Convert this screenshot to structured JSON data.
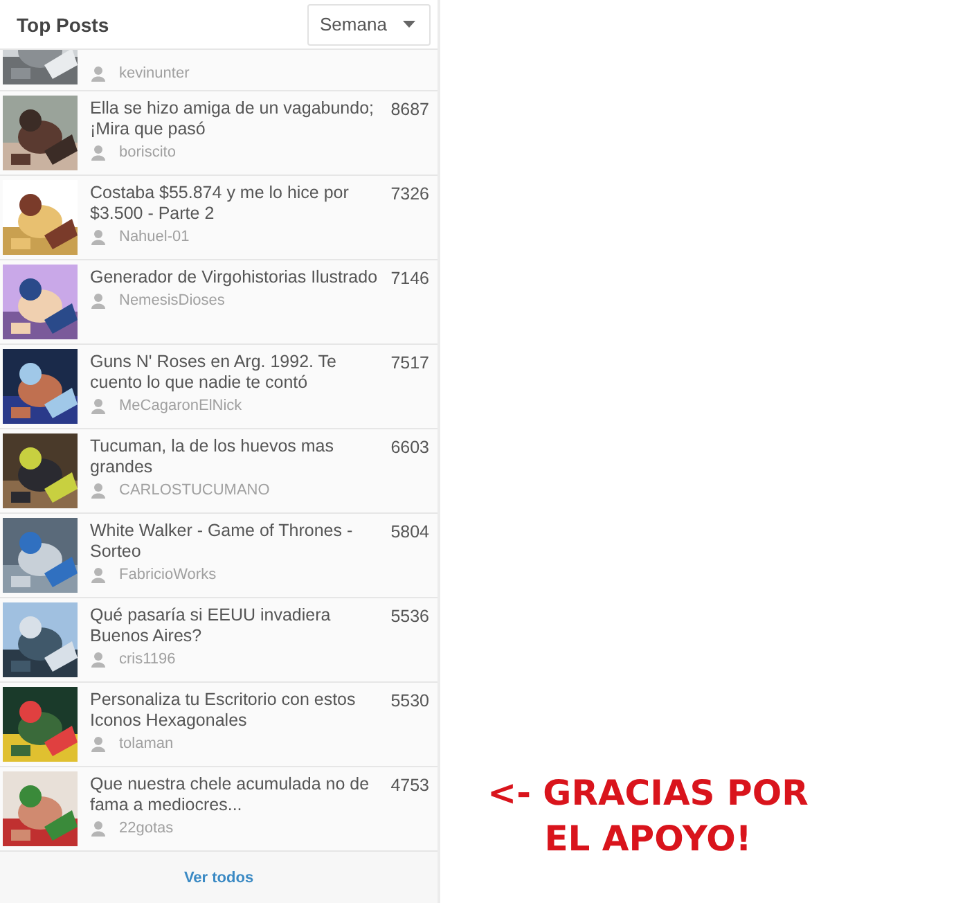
{
  "panel": {
    "title": "Top Posts",
    "period": {
      "value": "Semana"
    }
  },
  "posts": [
    {
      "kind": "partial",
      "author": "kevinunter"
    },
    {
      "kind": "full",
      "title": "Ella se hizo amiga de un vagabundo; ¡Mira que pasó",
      "author": "boriscito",
      "count": "8687"
    },
    {
      "kind": "full",
      "title": "Costaba $55.874 y me lo hice por $3.500 - Parte 2",
      "author": "Nahuel-01",
      "count": "7326"
    },
    {
      "kind": "full",
      "title": "Generador de Virgohistorias Ilustrado",
      "author": "NemesisDioses",
      "count": "7146"
    },
    {
      "kind": "full",
      "title": "Guns N' Roses en Arg. 1992. Te cuento lo que nadie te contó",
      "author": "MeCagaronElNick",
      "count": "7517"
    },
    {
      "kind": "full",
      "title": "Tucuman, la de los huevos mas grandes",
      "author": "CARLOSTUCUMANO",
      "count": "6603"
    },
    {
      "kind": "full",
      "title": "White Walker - Game of Thrones - Sorteo",
      "author": "FabricioWorks",
      "count": "5804"
    },
    {
      "kind": "full",
      "title": "Qué pasaría si EEUU invadiera Buenos Aires?",
      "author": "cris1196",
      "count": "5536"
    },
    {
      "kind": "full",
      "title": "Personaliza tu Escritorio con estos Iconos Hexagonales",
      "author": "tolaman",
      "count": "5530"
    },
    {
      "kind": "full",
      "title": "Que nuestra chele acumulada no de fama a mediocres...",
      "author": "22gotas",
      "count": "4753"
    }
  ],
  "footer": {
    "link": "Ver todos"
  },
  "annotation": {
    "lines": [
      "<- GRACIAS POR",
      "EL APOYO!"
    ]
  }
}
